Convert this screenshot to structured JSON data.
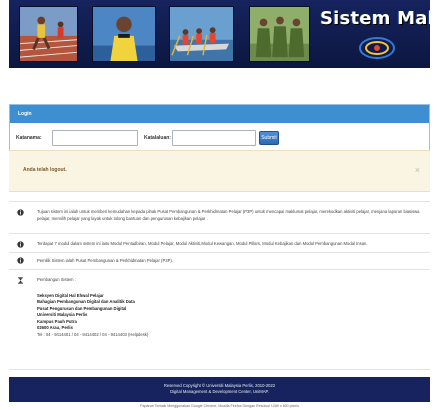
{
  "banner": {
    "title": "Sistem Maklumat",
    "photos": [
      "running-track-photo",
      "athlete-portrait-photo",
      "rowing-team-photo",
      "cadets-photo"
    ]
  },
  "login": {
    "header": "Login",
    "username_label": "Katanama:",
    "username_value": "",
    "password_label": "Katalaluan:",
    "password_value": "",
    "submit_label": "Submit"
  },
  "alert": {
    "message": "Anda telah logout.",
    "close": "×"
  },
  "info": {
    "item1": "Tujuan sistem ini ialah untuk memberi kemudahan kepada pihak Pusat Pembangunan & Perkhidmatan Pelajar (P3P) untuk mencapai maklumat pelajar, merekodkan aktiviti pelajar, menjana laporan biasiswa pelajar, memilih pelajar yang layak untuk tolong bantuan dan pengurusan kebajikan pelajar .",
    "item2": "Terdapat 7 modul dalam sistem ini iaitu Modul Pentadbiran, Modul Pelajar, Modul Aktiviti,Modul Kewangan, Modul Pillars, Modul Kebajikan dan Modul Pembangunan Modal Insan.",
    "item3": "Pemilik Sistem ialah Pusat Pembangunan & Perkhidmatan Pelajar (P3P).",
    "item4_heading": "Pembangun Sistem :",
    "dev_lines": [
      "Seksyen Digital Hal Ehwal Pelajar",
      "Bahagian Pembangunan Digital dan Analitik Data",
      "Pusat Pengurusan dan Pembangunan Digital",
      "Universiti Malaysia Perlis",
      "Kampus Pauh Putra",
      "02600 Arau, Perlis"
    ],
    "phone": "Tel : 04 - 9414401 / 04 - 9414402 / 04 - 9414403 (Helpdesk)"
  },
  "footer": {
    "line1": "Reserved Copyright © Universiti Malaysia Perlis, 2010-2022",
    "line2": "Digital Management & Development Center, UniMAP.",
    "subnote": "Paparan Terbaik Menggunakan Google Chrome, Mozilla Firefox Dengan Resolusi 1280 x 800 pixels"
  },
  "colors": {
    "banner_bg": "#16235e",
    "login_header": "#3d8fd1",
    "alert_bg": "#faf4e3",
    "footer_bg": "#16235e"
  }
}
